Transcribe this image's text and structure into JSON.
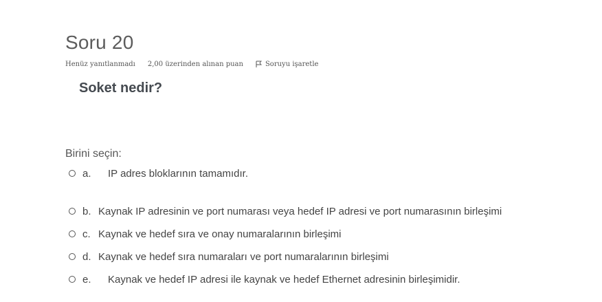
{
  "question": {
    "title": "Soru 20",
    "status": "Henüz yanıtlanmadı",
    "grade": "2,00 üzerinden alınan puan",
    "flag_label": "Soruyu işaretle",
    "text": "Soket nedir?",
    "prompt": "Birini seçin:"
  },
  "answers": [
    {
      "letter": "a.",
      "text": "IP adres bloklarının tamamıdır."
    },
    {
      "letter": "b.",
      "text": "Kaynak IP adresinin ve port numarası veya hedef IP adresi ve port numarasının birleşimi"
    },
    {
      "letter": "c.",
      "text": "Kaynak ve hedef sıra ve onay numaralarının birleşimi"
    },
    {
      "letter": "d.",
      "text": "Kaynak ve hedef sıra numaraları ve port numaralarının birleşimi"
    },
    {
      "letter": "e.",
      "text": "Kaynak ve hedef IP adresi ile kaynak ve hedef Ethernet adresinin birleşimidir."
    }
  ],
  "colors": {
    "title": "#5c5c5c",
    "text": "#444444"
  },
  "icons": {
    "flag": "flag-icon",
    "radio": "radio-icon"
  }
}
